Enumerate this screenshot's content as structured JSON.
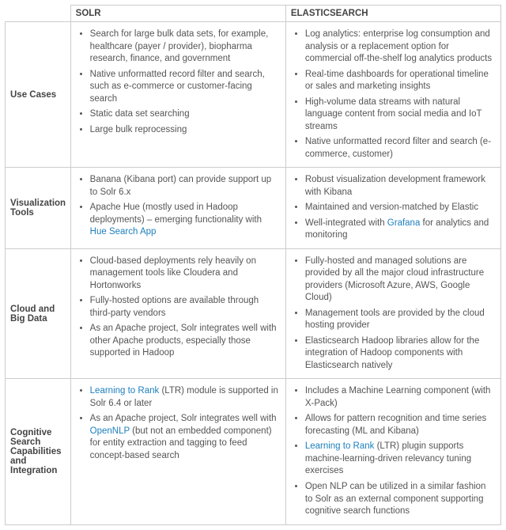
{
  "headers": {
    "solr": "SOLR",
    "es": "ELASTICSEARCH"
  },
  "rows": [
    {
      "label": "Use Cases",
      "solr": [
        [
          {
            "t": "Search for large bulk data sets, for example, healthcare (payer / provider), biopharma research, finance, and government"
          }
        ],
        [
          {
            "t": "Native unformatted record filter and search, such as e-commerce or customer-facing search"
          }
        ],
        [
          {
            "t": "Static data set searching"
          }
        ],
        [
          {
            "t": "Large bulk reprocessing"
          }
        ]
      ],
      "es": [
        [
          {
            "t": "Log analytics: enterprise log consumption and analysis or a replacement option for commercial off-the-shelf log analytics products"
          }
        ],
        [
          {
            "t": "Real-time dashboards for operational timeline or sales and marketing insights"
          }
        ],
        [
          {
            "t": "High-volume data streams with natural language content from social media and IoT streams"
          }
        ],
        [
          {
            "t": "Native unformatted record filter and search (e-commerce, customer)"
          }
        ]
      ]
    },
    {
      "label": "Visualization Tools",
      "solr": [
        [
          {
            "t": "Banana (Kibana port) can provide support up to Solr 6.x"
          }
        ],
        [
          {
            "t": "Apache Hue (mostly used in Hadoop deployments) – emerging functionality with "
          },
          {
            "t": "Hue Search App",
            "link": true
          }
        ]
      ],
      "es": [
        [
          {
            "t": "Robust visualization development framework with Kibana"
          }
        ],
        [
          {
            "t": "Maintained and version-matched by Elastic"
          }
        ],
        [
          {
            "t": "Well-integrated with "
          },
          {
            "t": "Grafana",
            "link": true
          },
          {
            "t": " for analytics and monitoring"
          }
        ]
      ]
    },
    {
      "label": "Cloud and Big Data",
      "solr": [
        [
          {
            "t": "Cloud-based deployments rely heavily on management tools like Cloudera and Hortonworks"
          }
        ],
        [
          {
            "t": "Fully-hosted options are available through third-party vendors"
          }
        ],
        [
          {
            "t": "As an Apache project, Solr integrates well with other Apache products, especially those supported in Hadoop"
          }
        ]
      ],
      "es": [
        [
          {
            "t": "Fully-hosted and managed solutions are provided by all the major cloud infrastructure providers (Microsoft Azure, AWS, Google Cloud)"
          }
        ],
        [
          {
            "t": "Management tools are provided by the cloud hosting provider"
          }
        ],
        [
          {
            "t": "Elasticsearch Hadoop libraries allow for the integration of Hadoop components with Elasticsearch natively"
          }
        ]
      ]
    },
    {
      "label": "Cognitive Search Capabilities and Integration",
      "solr": [
        [
          {
            "t": "Learning to Rank",
            "link": true
          },
          {
            "t": " (LTR) module is supported in Solr 6.4 or later"
          }
        ],
        [
          {
            "t": "As an Apache project, Solr integrates well with "
          },
          {
            "t": "OpenNLP",
            "link": true
          },
          {
            "t": " (but not an embedded component) for entity extraction and tagging to feed concept-based search"
          }
        ]
      ],
      "es": [
        [
          {
            "t": "Includes a Machine Learning component (with X-Pack)"
          }
        ],
        [
          {
            "t": "Allows for pattern recognition and time series forecasting (ML and Kibana)"
          }
        ],
        [
          {
            "t": "Learning to Rank",
            "link": true
          },
          {
            "t": " (LTR) plugin supports machine-learning-driven relevancy tuning exercises"
          }
        ],
        [
          {
            "t": "Open NLP can be utilized in a similar fashion to Solr as an external component supporting cognitive search functions"
          }
        ]
      ]
    }
  ]
}
